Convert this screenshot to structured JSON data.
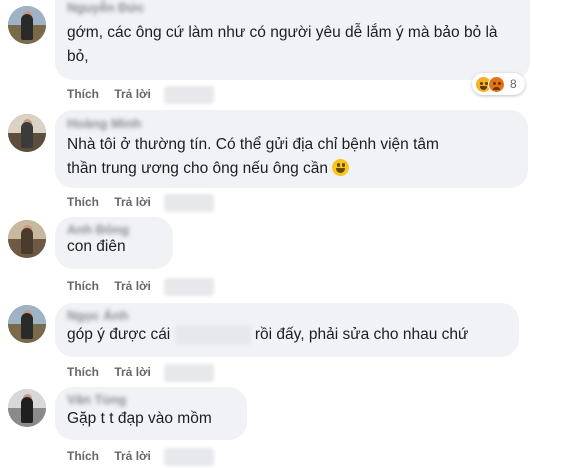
{
  "comments": [
    {
      "author": "Nguyễn Đức",
      "text": "gớm, các ông cứ làm như có người yêu dễ lắm ý mà bảo bỏ là bỏ,",
      "like": "Thích",
      "reply": "Trả lời",
      "reaction_count": "8",
      "reaction_icons": [
        "haha-icon",
        "angry-icon"
      ]
    },
    {
      "author": "Hoàng Minh",
      "text_line1": "Nhà tôi ở thường tín. Có thể gửi địa chỉ bệnh viện tâm",
      "text_line2": "thần trung ương cho ông nếu ông cần",
      "emoji": "grinning-emoji",
      "like": "Thích",
      "reply": "Trả lời"
    },
    {
      "author": "Anh Đông",
      "text": "con điên",
      "like": "Thích",
      "reply": "Trả lời"
    },
    {
      "author": "Ngọc Ánh",
      "text_before": "góp ý được cái",
      "text_after": "rồi đấy, phải sửa cho nhau chứ",
      "like": "Thích",
      "reply": "Trả lời"
    },
    {
      "author": "Văn Tùng",
      "text": "Gặp t t đạp vào mồm",
      "like": "Thích",
      "reply": "Trả lời"
    }
  ]
}
